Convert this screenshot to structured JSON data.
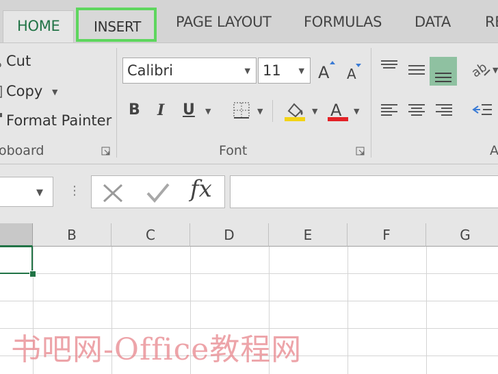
{
  "tabs": [
    {
      "label": "HOME"
    },
    {
      "label": "INSERT"
    },
    {
      "label": "PAGE LAYOUT"
    },
    {
      "label": "FORMULAS"
    },
    {
      "label": "DATA"
    },
    {
      "label": "RE"
    }
  ],
  "clipboard": {
    "cut_label": "Cut",
    "copy_label": "Copy",
    "format_painter_label": "Format Painter",
    "group_label": "oboard"
  },
  "font": {
    "font_name": "Calibri",
    "font_size": "11",
    "bold_label": "B",
    "italic_label": "I",
    "underline_label": "U",
    "group_label": "Font",
    "fill_color": "#f2d316",
    "font_color": "#e32227"
  },
  "alignment": {
    "group_label": "A"
  },
  "formula_bar": {
    "fx_label": "fx",
    "more_label": "⋮"
  },
  "columns": [
    "B",
    "C",
    "D",
    "E",
    "F",
    "G"
  ],
  "watermark": "书吧网-Office教程网",
  "colors": {
    "accent": "#217346",
    "highlight": "#5ed65e",
    "selected_button": "#8fc1a1"
  }
}
